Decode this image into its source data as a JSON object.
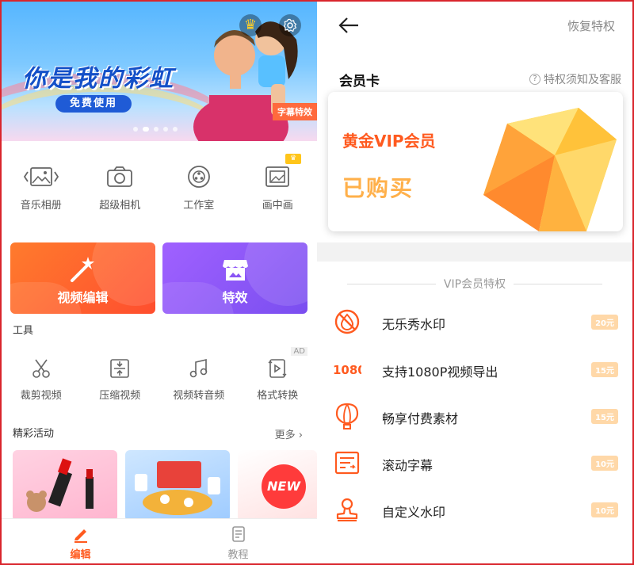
{
  "left": {
    "banner": {
      "headline": "你是我的彩虹",
      "free_button": "免费使用",
      "tag": "字幕特效"
    },
    "quick_actions": [
      {
        "label": "音乐相册",
        "icon": "photo-album-icon"
      },
      {
        "label": "超级相机",
        "icon": "camera-icon"
      },
      {
        "label": "工作室",
        "icon": "film-reel-icon"
      },
      {
        "label": "画中画",
        "icon": "picture-in-picture-icon",
        "badge": "crown"
      }
    ],
    "big_cards": [
      {
        "label": "视频编辑",
        "icon": "magic-wand-icon",
        "color": "#ff5a2e"
      },
      {
        "label": "特效",
        "icon": "store-effects-icon",
        "color": "#8a55f5"
      }
    ],
    "tools_title": "工具",
    "tools": [
      {
        "label": "裁剪视频",
        "icon": "scissors-icon"
      },
      {
        "label": "压缩视频",
        "icon": "compress-icon"
      },
      {
        "label": "视频转音频",
        "icon": "music-note-icon"
      },
      {
        "label": "格式转换",
        "icon": "format-convert-icon",
        "badge": "AD"
      }
    ],
    "activities_title": "精彩活动",
    "more": "更多",
    "promo_new": "NEW",
    "tabbar": [
      {
        "label": "编辑",
        "icon": "edit-icon",
        "active": true
      },
      {
        "label": "教程",
        "icon": "tutorial-icon",
        "active": false
      }
    ]
  },
  "right": {
    "restore": "恢复特权",
    "card_title": "会员卡",
    "help": "特权须知及客服",
    "vip_name": "黄金VIP会员",
    "vip_status": "已购买",
    "perks_title": "VIP会员特权",
    "perks": [
      {
        "label": "无乐秀水印",
        "price": "20元",
        "icon": "no-watermark-icon"
      },
      {
        "label": "支持1080P视频导出",
        "price": "15元",
        "icon": "hd-1080-icon"
      },
      {
        "label": "畅享付费素材",
        "price": "15元",
        "icon": "balloon-icon"
      },
      {
        "label": "滚动字幕",
        "price": "10元",
        "icon": "scrolling-subtitle-icon"
      },
      {
        "label": "自定义水印",
        "price": "10元",
        "icon": "stamp-icon"
      }
    ],
    "accent_color": "#ff5a1f"
  }
}
